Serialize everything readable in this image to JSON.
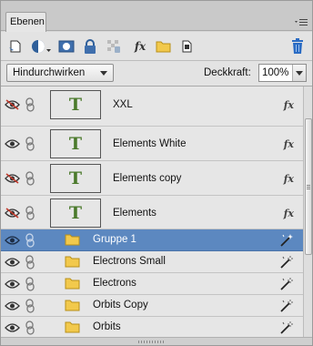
{
  "panel": {
    "tab_label": "Ebenen"
  },
  "toolbar": {
    "icons": [
      "new-layer-icon",
      "adjustment-layer-icon",
      "layer-mask-icon",
      "lock-all-icon",
      "lock-transparency-icon",
      "layer-style-icon",
      "new-group-icon",
      "link-icon",
      "delete-layer-icon"
    ],
    "fx_label": "fx"
  },
  "options": {
    "blend_mode": "Hindurchwirken",
    "opacity_label": "Deckkraft:",
    "opacity_value": "100%"
  },
  "layers": [
    {
      "name": "XXL",
      "kind": "text",
      "visible": false,
      "thumb": "T",
      "fx": "fx"
    },
    {
      "name": "Elements White",
      "kind": "text",
      "visible": true,
      "thumb": "T",
      "fx": "fx"
    },
    {
      "name": "Elements copy",
      "kind": "text",
      "visible": false,
      "thumb": "T",
      "fx": "fx"
    },
    {
      "name": "Elements",
      "kind": "text",
      "visible": false,
      "thumb": "T",
      "fx": "fx"
    },
    {
      "name": "Gruppe 1",
      "kind": "group",
      "visible": true,
      "selected": true
    },
    {
      "name": "Electrons Small",
      "kind": "group",
      "visible": true
    },
    {
      "name": "Electrons",
      "kind": "group",
      "visible": true
    },
    {
      "name": "Orbits Copy",
      "kind": "group",
      "visible": true
    },
    {
      "name": "Orbits",
      "kind": "group",
      "visible": true
    }
  ],
  "colors": {
    "selection": "#5c88c0",
    "text_thumb": "#4b7a2c",
    "folder": "#f2c94c",
    "trash": "#2b6cc4"
  }
}
